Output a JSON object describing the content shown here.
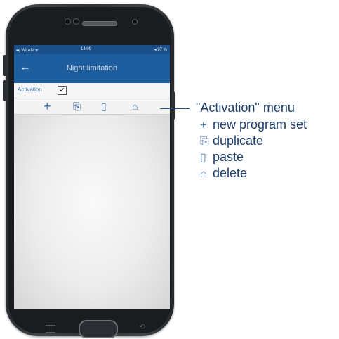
{
  "statusbar": {
    "left": "▪▪| WLAN ᯤ",
    "time": "14:09",
    "battery": "◂ 97 %"
  },
  "appbar": {
    "back_icon": "←",
    "title": "Night limitation"
  },
  "activation": {
    "label": "Activation",
    "checked_mark": "✔"
  },
  "toolbar": {
    "icons": [
      "plus-icon",
      "duplicate-icon",
      "paste-icon",
      "delete-icon"
    ],
    "glyphs": [
      "+",
      "⎘",
      "▯",
      "⌂"
    ]
  },
  "callout": {
    "title": "\"Activation\" menu",
    "items": [
      {
        "icon": "+",
        "label": "new program set"
      },
      {
        "icon": "⎘",
        "label": "duplicate"
      },
      {
        "icon": "▯",
        "label": "paste"
      },
      {
        "icon": "⌂",
        "label": "delete"
      }
    ]
  },
  "colors": {
    "appbar": "#1f5e9e",
    "accent": "#3b76b8",
    "legend_text": "#1e3f6b"
  }
}
